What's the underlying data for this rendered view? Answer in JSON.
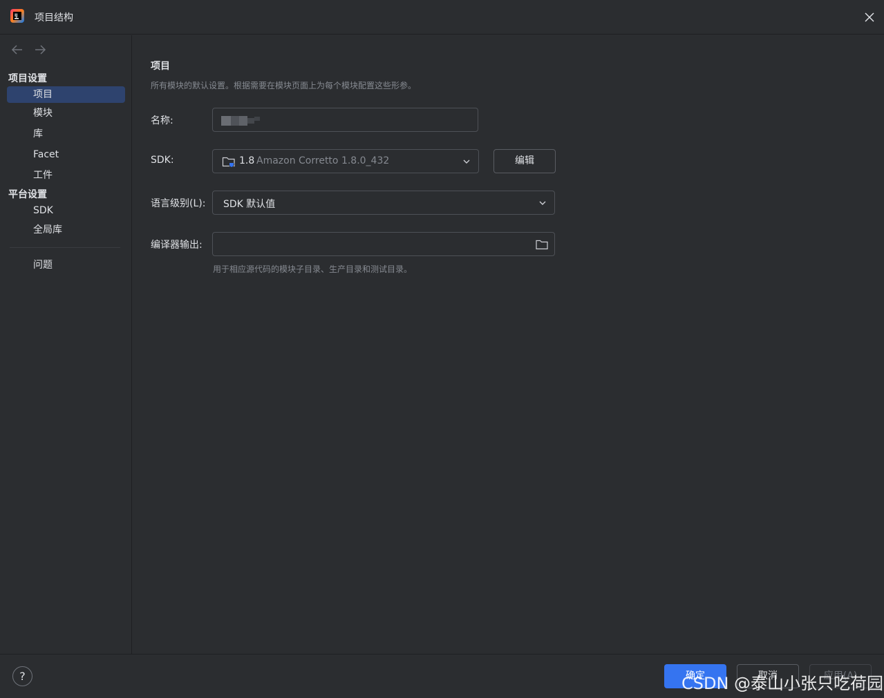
{
  "window": {
    "title": "项目结构"
  },
  "sidebar": {
    "sections": [
      {
        "header": "项目设置",
        "items": [
          "项目",
          "模块",
          "库",
          "Facet",
          "工件"
        ]
      },
      {
        "header": "平台设置",
        "items": [
          "SDK",
          "全局库"
        ]
      }
    ],
    "problems_label": "问题",
    "selected_item": "项目"
  },
  "main": {
    "title": "项目",
    "description": "所有模块的默认设置。根据需要在模块页面上为每个模块配置这些形参。",
    "name_label": "名称:",
    "sdk_label": "SDK:",
    "sdk_version": "1.8",
    "sdk_name": "Amazon Corretto 1.8.0_432",
    "edit_button": "编辑",
    "language_level_label": "语言级别(L):",
    "language_level_value": "SDK 默认值",
    "compiler_output_label": "编译器输出:",
    "compiler_output_value": "",
    "compiler_output_hint": "用于相应源代码的模块子目录、生产目录和测试目录。"
  },
  "footer": {
    "help_label": "?",
    "ok_button": "确定",
    "cancel_button": "取消",
    "apply_button": "应用(A)"
  },
  "watermark": "CSDN @泰山小张只吃荷园",
  "colors": {
    "background": "#2b2d30",
    "selected": "#2e436e",
    "accent": "#3574f0",
    "text": "#dfe1e5",
    "muted_text": "#868a91",
    "border": "#4e5157"
  },
  "icons": {
    "app_logo": "intellij-idea-logo",
    "close": "close-icon",
    "back": "arrow-left-icon",
    "forward": "arrow-right-icon",
    "sdk_folder": "sdk-folder-icon",
    "dropdown": "chevron-down-icon",
    "browse": "folder-icon",
    "help": "help-icon"
  }
}
